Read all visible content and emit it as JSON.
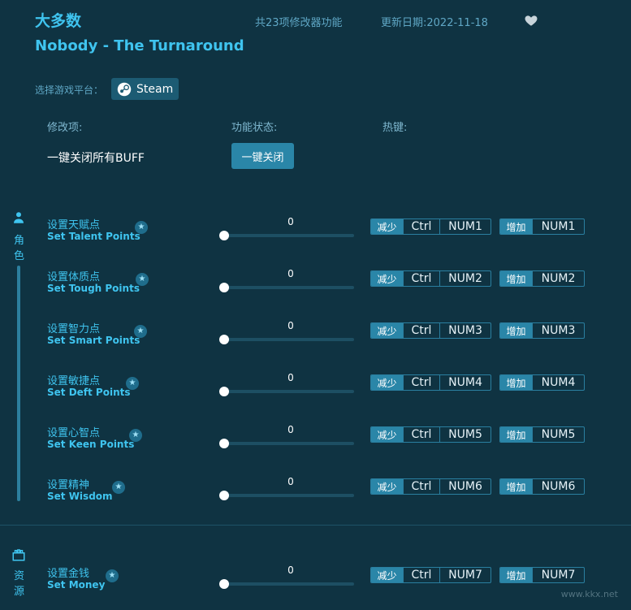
{
  "header": {
    "brand": "大多数",
    "feature_count": "共23项修改器功能",
    "update_date": "更新日期:2022-11-18",
    "game_title": "Nobody - The Turnaround"
  },
  "platform": {
    "label": "选择游戏平台：",
    "steam": "Steam"
  },
  "columns": {
    "item": "修改项:",
    "status": "功能状态:",
    "hotkey": "热键:"
  },
  "buff": {
    "label": "一键关闭所有BUFF",
    "button": "一键关闭"
  },
  "sidebar": {
    "role": {
      "line1": "角",
      "line2": "色"
    },
    "resource": {
      "line1": "资",
      "line2": "源"
    }
  },
  "hotkey_tags": {
    "decrease": "减少",
    "increase": "增加",
    "ctrl": "Ctrl"
  },
  "rows": [
    {
      "zh": "设置天赋点",
      "en": "Set Talent Points",
      "value": "0",
      "key": "NUM1"
    },
    {
      "zh": "设置体质点",
      "en": "Set Tough Points",
      "value": "0",
      "key": "NUM2"
    },
    {
      "zh": "设置智力点",
      "en": "Set Smart Points",
      "value": "0",
      "key": "NUM3"
    },
    {
      "zh": "设置敏捷点",
      "en": "Set Deft Points",
      "value": "0",
      "key": "NUM4"
    },
    {
      "zh": "设置心智点",
      "en": "Set Keen Points",
      "value": "0",
      "key": "NUM5"
    },
    {
      "zh": "设置精神",
      "en": "Set Wisdom",
      "value": "0",
      "key": "NUM6"
    },
    {
      "zh": "设置金钱",
      "en": "Set Money",
      "value": "0",
      "key": "NUM7"
    }
  ],
  "watermark": "www.kkx.net"
}
